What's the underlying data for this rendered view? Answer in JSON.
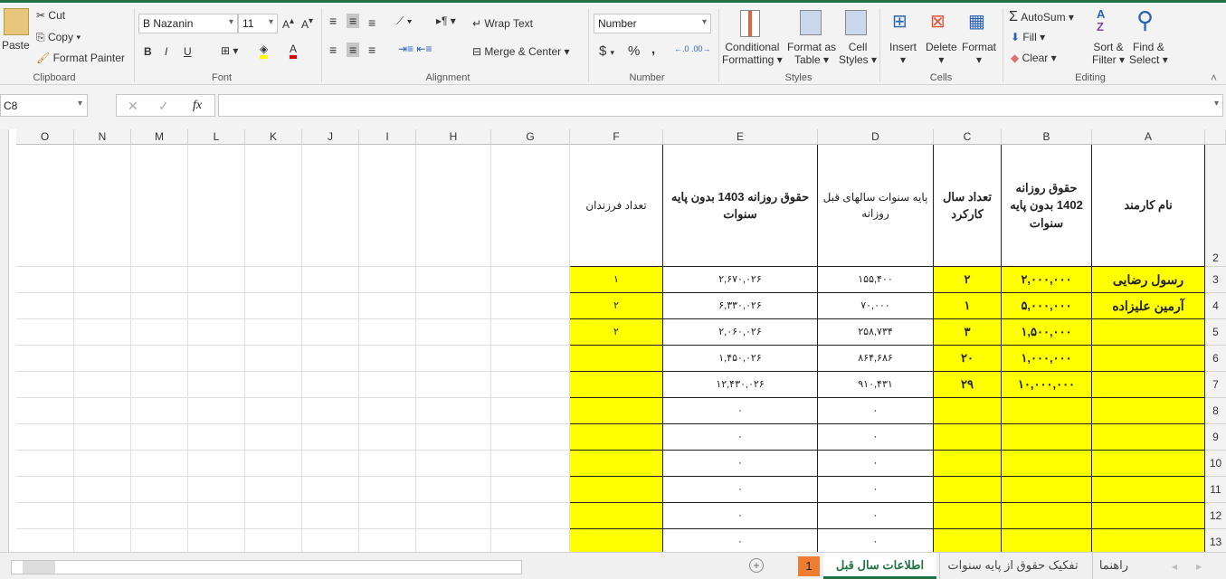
{
  "ribbon": {
    "clipboard": {
      "label": "Clipboard",
      "paste": "Paste",
      "cut": "Cut",
      "copy": "Copy",
      "format_painter": "Format Painter"
    },
    "font": {
      "label": "Font",
      "font_name": "B Nazanin",
      "font_size": "11",
      "bold": "B",
      "italic": "I",
      "underline": "U"
    },
    "alignment": {
      "label": "Alignment",
      "wrap_text": "Wrap Text",
      "merge_center": "Merge & Center"
    },
    "number": {
      "label": "Number",
      "format": "Number",
      "currency": "$",
      "percent": "%",
      "comma": ","
    },
    "styles": {
      "label": "Styles",
      "conditional": "Conditional",
      "conditional2": "Formatting",
      "format_table": "Format as",
      "format_table2": "Table",
      "cell_styles": "Cell",
      "cell_styles2": "Styles"
    },
    "cells": {
      "label": "Cells",
      "insert": "Insert",
      "delete": "Delete",
      "format": "Format"
    },
    "editing": {
      "label": "Editing",
      "autosum": "AutoSum",
      "fill": "Fill",
      "clear": "Clear",
      "sort": "Sort &",
      "sort2": "Filter",
      "find": "Find &",
      "find2": "Select"
    }
  },
  "formula_bar": {
    "name_box": "C8",
    "fx": "fx",
    "cancel": "✕",
    "enter": "✓",
    "formula": ""
  },
  "colors": {
    "highlight": "#ffff00",
    "accent": "#217346",
    "tab_badge": "#ed7d31"
  },
  "columns": [
    "A",
    "B",
    "C",
    "D",
    "E",
    "F",
    "G",
    "H",
    "I",
    "J",
    "K",
    "L",
    "M",
    "N",
    "O"
  ],
  "highlight_columns": [
    "A",
    "B",
    "C",
    "F"
  ],
  "rows": [
    {
      "n": "2",
      "A": "نام کارمند",
      "B": "حقوق روزانه 1402 بدون پایه سنوات",
      "C": "تعداد سال کارکرد",
      "D": "پایه سنوات سالهای قبل روزانه",
      "E": "حقوق روزانه 1403 بدون پایه سنوات",
      "F": "تعداد فرزندان"
    },
    {
      "n": "3",
      "A": "رسول رضایی",
      "B": "۲,۰۰۰,۰۰۰",
      "C": "۲",
      "D": "۱۵۵,۴۰۰",
      "E": "۲,۶۷۰,۰۲۶",
      "F": "۱"
    },
    {
      "n": "4",
      "A": "آرمین علیزاده",
      "B": "۵,۰۰۰,۰۰۰",
      "C": "۱",
      "D": "۷۰,۰۰۰",
      "E": "۶,۳۳۰,۰۲۶",
      "F": "۲"
    },
    {
      "n": "5",
      "A": "",
      "B": "۱,۵۰۰,۰۰۰",
      "C": "۳",
      "D": "۲۵۸,۷۳۴",
      "E": "۲,۰۶۰,۰۲۶",
      "F": "۲"
    },
    {
      "n": "6",
      "A": "",
      "B": "۱,۰۰۰,۰۰۰",
      "C": "۲۰",
      "D": "۸۶۴,۶۸۶",
      "E": "۱,۴۵۰,۰۲۶",
      "F": ""
    },
    {
      "n": "7",
      "A": "",
      "B": "۱۰,۰۰۰,۰۰۰",
      "C": "۲۹",
      "D": "۹۱۰,۴۳۱",
      "E": "۱۲,۴۳۰,۰۲۶",
      "F": ""
    },
    {
      "n": "8",
      "A": "",
      "B": "",
      "C": "",
      "D": "۰",
      "E": "۰",
      "F": ""
    },
    {
      "n": "9",
      "A": "",
      "B": "",
      "C": "",
      "D": "۰",
      "E": "۰",
      "F": ""
    },
    {
      "n": "10",
      "A": "",
      "B": "",
      "C": "",
      "D": "۰",
      "E": "۰",
      "F": ""
    },
    {
      "n": "11",
      "A": "",
      "B": "",
      "C": "",
      "D": "۰",
      "E": "۰",
      "F": ""
    },
    {
      "n": "12",
      "A": "",
      "B": "",
      "C": "",
      "D": "۰",
      "E": "۰",
      "F": ""
    },
    {
      "n": "13",
      "A": "",
      "B": "",
      "C": "",
      "D": "۰",
      "E": "۰",
      "F": ""
    }
  ],
  "sheet_tabs": [
    {
      "label": "راهنما",
      "active": false
    },
    {
      "label": "تفکیک حقوق از پایه سنوات",
      "active": false
    },
    {
      "label": "اطلاعات سال قبل",
      "active": true
    },
    {
      "label": "1",
      "badge": true
    }
  ]
}
